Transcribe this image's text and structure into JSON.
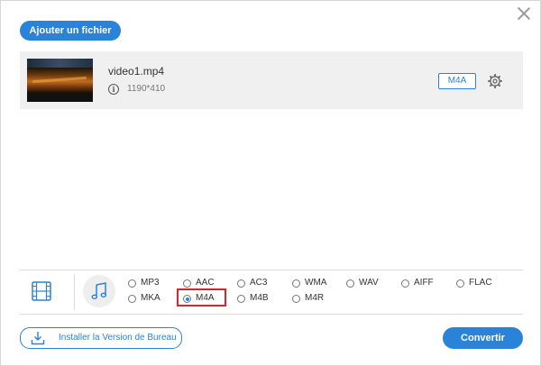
{
  "toolbar": {
    "add_file_label": "Ajouter un fichier"
  },
  "file": {
    "name": "video1.mp4",
    "resolution": "1190*410",
    "output_format": "M4A"
  },
  "formats": {
    "row1": [
      "MP3",
      "AAC",
      "AC3",
      "WMA",
      "WAV",
      "AIFF",
      "FLAC"
    ],
    "row2": [
      "MKA",
      "M4A",
      "M4B",
      "M4R"
    ],
    "selected": "M4A"
  },
  "footer": {
    "install_label": "Installer la Version de Bureau",
    "convert_label": "Convertir"
  },
  "colors": {
    "accent": "#2b82d9",
    "highlight": "#d9242f"
  },
  "icons": {
    "close": "close-icon",
    "info": "info-icon",
    "settings": "gear-icon",
    "video_tab": "film-icon",
    "audio_tab": "music-note-icon",
    "download": "download-icon"
  }
}
